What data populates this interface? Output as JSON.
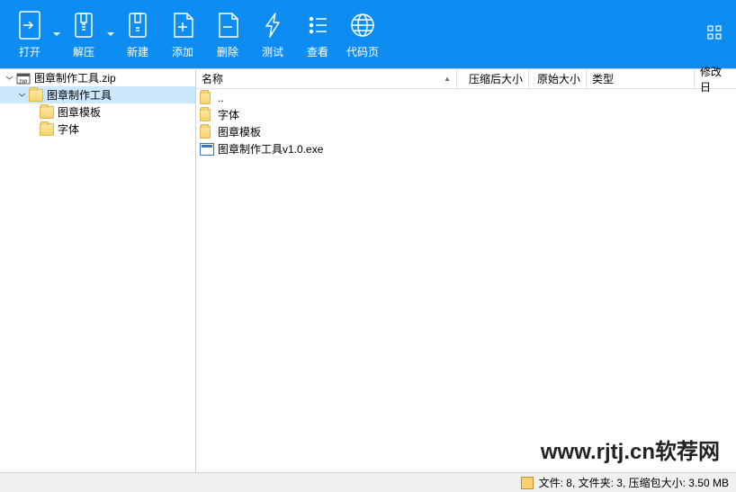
{
  "toolbar": {
    "open": "打开",
    "extract": "解压",
    "new": "新建",
    "add": "添加",
    "delete": "删除",
    "test": "测试",
    "view": "查看",
    "codepage": "代码页"
  },
  "tree": {
    "root": "图章制作工具.zip",
    "items": [
      {
        "label": "图章制作工具",
        "depth": 1,
        "selected": true,
        "expanded": true
      },
      {
        "label": "图章模板",
        "depth": 2,
        "selected": false
      },
      {
        "label": "字体",
        "depth": 2,
        "selected": false
      }
    ]
  },
  "columns": {
    "name": "名称",
    "packed": "压缩后大小",
    "original": "原始大小",
    "type": "类型",
    "modified": "修改日"
  },
  "rows": [
    {
      "name": "..",
      "icon": "folder"
    },
    {
      "name": "字体",
      "icon": "folder"
    },
    {
      "name": "图章模板",
      "icon": "folder"
    },
    {
      "name": "图章制作工具v1.0.exe",
      "icon": "exe"
    }
  ],
  "status": {
    "text": "文件: 8, 文件夹: 3, 压缩包大小: 3.50 MB"
  },
  "watermark": "www.rjtj.cn软荐网"
}
